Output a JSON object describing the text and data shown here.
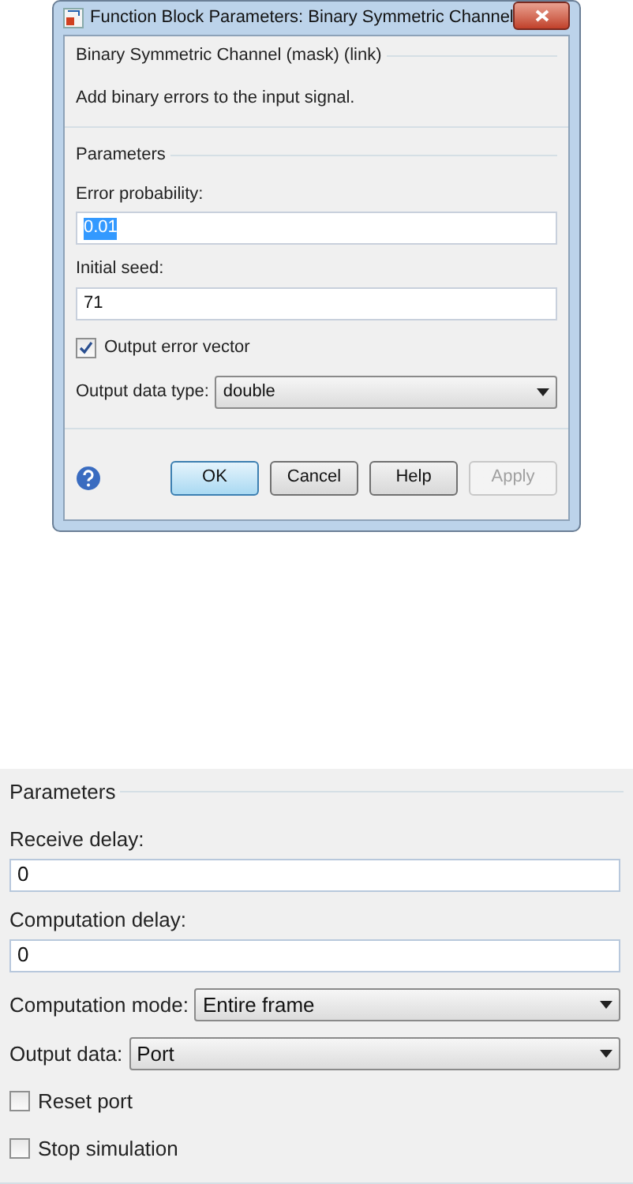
{
  "dialog": {
    "title": "Function Block Parameters: Binary Symmetric Channel",
    "mask_title": "Binary Symmetric Channel (mask) (link)",
    "description": "Add binary errors to the input signal.",
    "group_title": "Parameters",
    "parameters": [
      {
        "kind": "text",
        "label": "Error probability:",
        "value": "0.01",
        "highlighted": true
      },
      {
        "kind": "text",
        "label": "Initial seed:",
        "value": "71",
        "highlighted": false
      },
      {
        "kind": "checkbox",
        "label": "Output error vector",
        "checked": true
      },
      {
        "kind": "dropdown",
        "label": "Output data type:",
        "value": "double"
      }
    ],
    "buttons": [
      {
        "label": "OK",
        "default": true,
        "disabled": false
      },
      {
        "label": "Cancel",
        "default": false,
        "disabled": false
      },
      {
        "label": "Help",
        "default": false,
        "disabled": false
      },
      {
        "label": "Apply",
        "default": false,
        "disabled": true
      }
    ]
  },
  "panel": {
    "group_title": "Parameters",
    "parameters": [
      {
        "kind": "text",
        "label": "Receive delay:",
        "value": "0",
        "highlighted": false
      },
      {
        "kind": "text",
        "label": "Computation delay:",
        "value": "0",
        "highlighted": false
      },
      {
        "kind": "dropdown",
        "label": "Computation mode:",
        "value": "Entire frame"
      },
      {
        "kind": "dropdown",
        "label": "Output data:",
        "value": "Port"
      },
      {
        "kind": "checkbox",
        "label": "Reset port",
        "checked": false
      },
      {
        "kind": "checkbox",
        "label": "Stop simulation",
        "checked": false
      }
    ]
  }
}
